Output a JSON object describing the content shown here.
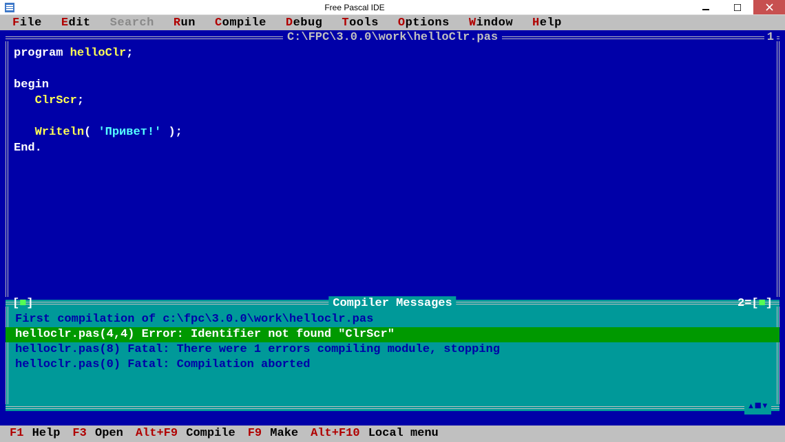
{
  "window": {
    "title": "Free Pascal IDE"
  },
  "menu": {
    "items": [
      {
        "hot": "F",
        "rest": "ile"
      },
      {
        "hot": "E",
        "rest": "dit"
      },
      {
        "hot": "S",
        "rest": "earch",
        "disabled": true
      },
      {
        "hot": "R",
        "rest": "un"
      },
      {
        "hot": "C",
        "rest": "ompile"
      },
      {
        "hot": "D",
        "rest": "ebug"
      },
      {
        "hot": "T",
        "rest": "ools"
      },
      {
        "hot": "O",
        "rest": "ptions"
      },
      {
        "hot": "W",
        "rest": "indow"
      },
      {
        "hot": "H",
        "rest": "elp"
      }
    ]
  },
  "editor": {
    "title": "C:\\FPC\\3.0.0\\work\\helloClr.pas",
    "frame_number": "1",
    "code_tokens": [
      [
        {
          "t": "program",
          "c": "keyword"
        },
        {
          "t": " ",
          "c": ""
        },
        {
          "t": "helloClr",
          "c": "ident"
        },
        {
          "t": ";",
          "c": "keyword"
        }
      ],
      [],
      [
        {
          "t": "begin",
          "c": "keyword"
        }
      ],
      [
        {
          "t": "   ",
          "c": ""
        },
        {
          "t": "ClrScr",
          "c": "ident"
        },
        {
          "t": ";",
          "c": "keyword"
        }
      ],
      [],
      [
        {
          "t": "   ",
          "c": ""
        },
        {
          "t": "Writeln",
          "c": "ident"
        },
        {
          "t": "( ",
          "c": "keyword"
        },
        {
          "t": "'Привет!'",
          "c": "string"
        },
        {
          "t": " );",
          "c": "keyword"
        }
      ],
      [
        {
          "t": "End",
          "c": "keyword"
        },
        {
          "t": ".",
          "c": "keyword"
        }
      ]
    ]
  },
  "messages": {
    "title": "Compiler Messages",
    "pane_number": "2",
    "close_glyph_l": "[",
    "close_glyph_c": "■",
    "close_glyph_r": "]",
    "num_glyph_l": "=[",
    "num_glyph_c": "■",
    "num_glyph_r": "]",
    "bottom_glyph": "▴■▾",
    "lines": [
      {
        "text": "First compilation of c:\\fpc\\3.0.0\\work\\helloclr.pas",
        "selected": false
      },
      {
        "text": "helloclr.pas(4,4) Error: Identifier not found \"ClrScr\"",
        "selected": true
      },
      {
        "text": "helloclr.pas(8) Fatal: There were 1 errors compiling module, stopping",
        "selected": false
      },
      {
        "text": "helloclr.pas(0) Fatal: Compilation aborted",
        "selected": false
      }
    ]
  },
  "status": {
    "items": [
      {
        "key": "F1",
        "label": "Help"
      },
      {
        "key": "F3",
        "label": "Open"
      },
      {
        "key": "Alt+F9",
        "label": "Compile"
      },
      {
        "key": "F9",
        "label": "Make"
      },
      {
        "key": "Alt+F10",
        "label": "Local menu"
      }
    ]
  }
}
